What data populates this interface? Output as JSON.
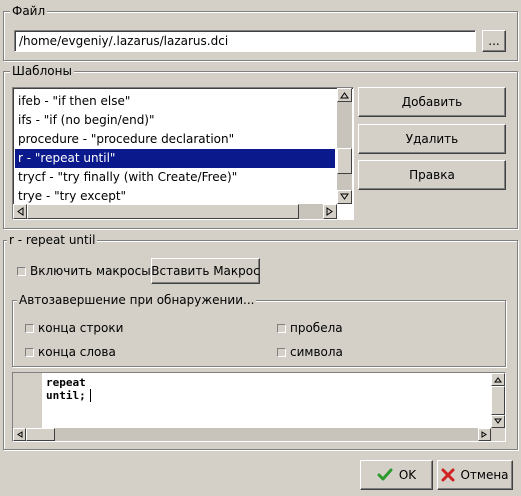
{
  "file_group": {
    "title": "Файл",
    "path": "/home/evgeniy/.lazarus/lazarus.dci",
    "browse_label": "..."
  },
  "templates_group": {
    "title": "Шаблоны",
    "items": [
      "ifeb - \"if then else\"",
      "ifs - \"if (no begin/end)\"",
      "procedure - \"procedure declaration\"",
      "r - \"repeat until\"",
      "trycf - \"try finally (with Create/Free)\"",
      "trye - \"try except\""
    ],
    "selected_index": 3,
    "add_label": "Добавить",
    "delete_label": "Удалить",
    "edit_label": "Правка"
  },
  "edit_group": {
    "title": "r - repeat until",
    "enable_macros_label": "Включить макросы",
    "insert_macro_label": "Вставить Макрос",
    "autocomplete": {
      "title": "Автозавершение при обнаружении...",
      "line_end": "конца строки",
      "space": "пробела",
      "word_end": "конца слова",
      "symbol": "символа"
    },
    "code_lines": [
      "repeat",
      "until;"
    ]
  },
  "footer": {
    "ok_label": "OK",
    "cancel_label": "Отмена"
  },
  "colors": {
    "selection": "#0a1a8c",
    "ok_check": "#2e9a2e",
    "cancel_x": "#d02020"
  },
  "icons": {
    "ok": "check-icon",
    "cancel": "x-icon"
  }
}
